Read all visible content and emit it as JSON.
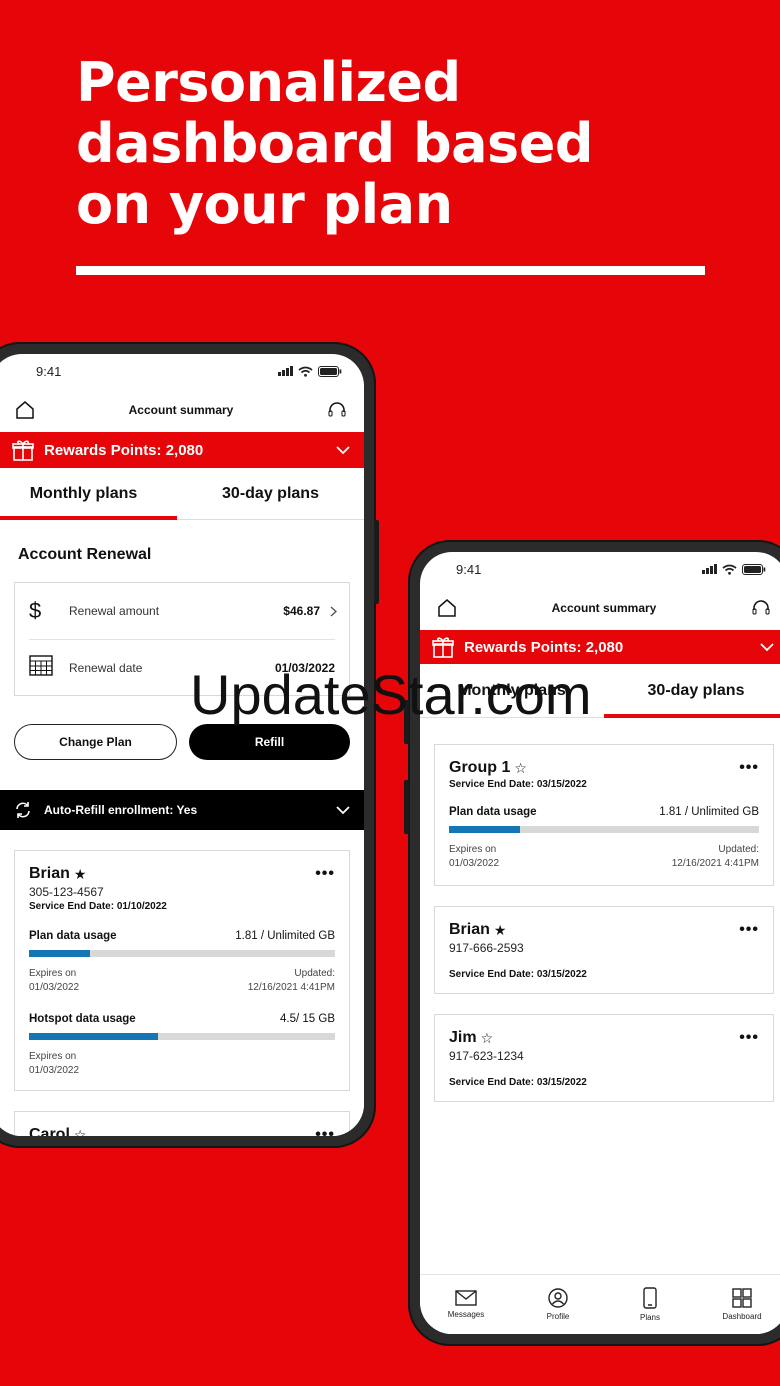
{
  "headline": {
    "line1": "Personalized",
    "line2": "dashboard based",
    "line3": "on your plan"
  },
  "watermark": "UpdateStar.com",
  "phone_left": {
    "status_time": "9:41",
    "title": "Account summary",
    "rewards": "Rewards Points: 2,080",
    "tabs": [
      "Monthly plans",
      "30-day plans"
    ],
    "section_title": "Account Renewal",
    "renewal": {
      "amount_label": "Renewal amount",
      "amount_value": "$46.87",
      "date_label": "Renewal date",
      "date_value": "01/03/2022"
    },
    "buttons": {
      "change": "Change Plan",
      "refill": "Refill"
    },
    "autorefill": "Auto-Refill enrollment: Yes",
    "lines": [
      {
        "name": "Brian",
        "star": "★",
        "phone": "305-123-4567",
        "service_end": "Service End Date: 01/10/2022",
        "plan_label": "Plan data usage",
        "plan_value": "1.81 / Unlimited GB",
        "plan_fill": 0.2,
        "expires_label": "Expires on",
        "expires_date": "01/03/2022",
        "updated_label": "Updated:",
        "updated_value": "12/16/2021 4:41PM",
        "hotspot_label": "Hotspot data usage",
        "hotspot_value": "4.5/ 15 GB",
        "hotspot_fill": 0.42,
        "hotspot_expires_label": "Expires on",
        "hotspot_expires_date": "01/03/2022"
      },
      {
        "name": "Carol",
        "star": "☆"
      }
    ]
  },
  "phone_right": {
    "status_time": "9:41",
    "title": "Account summary",
    "rewards": "Rewards Points: 2,080",
    "tabs": [
      "Monthly plans",
      "30-day plans"
    ],
    "lines": [
      {
        "name": "Group 1",
        "star": "☆",
        "service_end": "Service End Date: 03/15/2022",
        "plan_label": "Plan data usage",
        "plan_value": "1.81 / Unlimited GB",
        "plan_fill": 0.23,
        "expires_label": "Expires on",
        "expires_date": "01/03/2022",
        "updated_label": "Updated:",
        "updated_value": "12/16/2021 4:41PM"
      },
      {
        "name": "Brian",
        "star": "★",
        "phone": "917-666-2593",
        "service_end": "Service End Date: 03/15/2022"
      },
      {
        "name": "Jim",
        "star": "☆",
        "phone": "917-623-1234",
        "service_end": "Service End Date: 03/15/2022"
      }
    ],
    "nav": [
      "Messages",
      "Profile",
      "Plans",
      "Dashboard"
    ]
  },
  "colors": {
    "brand_red": "#e60508",
    "usage_blue": "#1576b5",
    "black": "#000000"
  }
}
